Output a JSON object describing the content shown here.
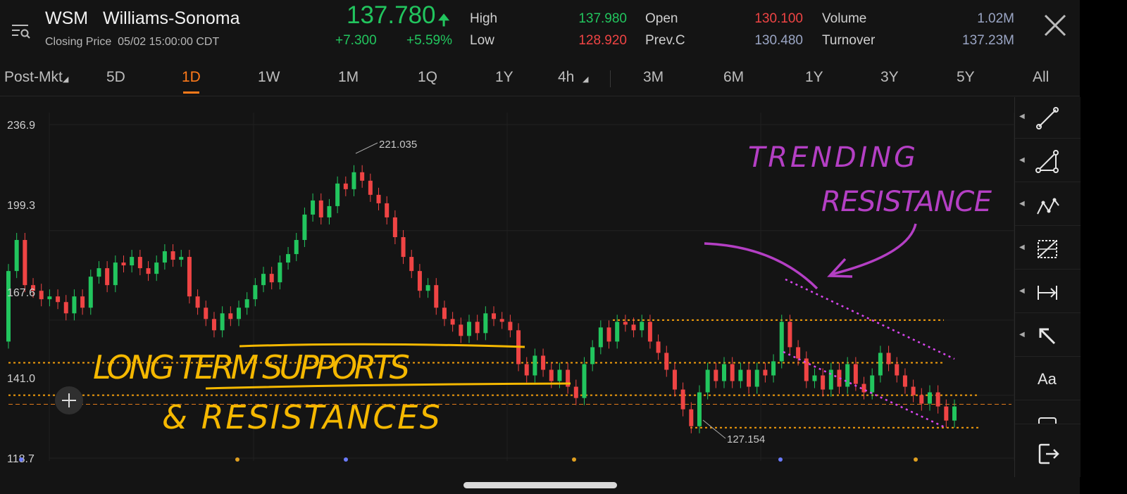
{
  "header": {
    "symbol": "WSM",
    "company": "Williams-Sonoma",
    "closing_label": "Closing Price",
    "closing_time": "05/02 15:00:00 CDT",
    "price": "137.780",
    "change": "+7.300",
    "change_pct": "+5.59%",
    "stats": {
      "high_label": "High",
      "high": "137.980",
      "low_label": "Low",
      "low": "128.920",
      "open_label": "Open",
      "open": "130.100",
      "prevc_label": "Prev.C",
      "prevc": "130.480",
      "volume_label": "Volume",
      "volume": "1.02M",
      "turnover_label": "Turnover",
      "turnover": "137.23M"
    },
    "colors": {
      "up": "#22c55e",
      "down": "#ef4444",
      "accent": "#ff7a1a"
    }
  },
  "tabs": [
    "Post-Mkt",
    "5D",
    "1D",
    "1W",
    "1M",
    "1Q",
    "1Y",
    "4h",
    "3M",
    "6M",
    "1Y",
    "3Y",
    "5Y",
    "All"
  ],
  "active_tab": "1D",
  "chart": {
    "y_ticks": [
      "236.9",
      "199.3",
      "167.6",
      "141.0",
      "118.7"
    ],
    "max_label": "221.035",
    "min_label": "127.154",
    "annotation_yellow_1": "LONG TERM SUPPORTS",
    "annotation_yellow_2": "& RESISTANCES",
    "annotation_purple_1": "TRENDING",
    "annotation_purple_2": "RESISTANCE",
    "support_levels": [
      167.6,
      152.5,
      141.0,
      129.5
    ],
    "current_price_line": 137.78
  },
  "toolbar": {
    "tools": [
      "line-tool-icon",
      "triangle-tool-icon",
      "pattern-tool-icon",
      "fib-tool-icon",
      "measure-tool-icon",
      "arrow-tool-icon",
      "text-tool-icon",
      "rect-tool-icon"
    ],
    "text_tool_label": "Aa"
  },
  "chart_data": {
    "type": "candlestick",
    "ylim": [
      118.7,
      236.9
    ],
    "y_ticks": [
      236.9,
      199.3,
      167.6,
      141.0,
      118.7
    ],
    "max": 221.035,
    "min": 127.154,
    "series": [
      {
        "name": "price",
        "values": [
          [
            160,
            185
          ],
          [
            185,
            196
          ],
          [
            196,
            180
          ],
          [
            180,
            178
          ],
          [
            178,
            175
          ],
          [
            175,
            176
          ],
          [
            176,
            174
          ],
          [
            174,
            170
          ],
          [
            170,
            176
          ],
          [
            176,
            172
          ],
          [
            172,
            183
          ],
          [
            183,
            186
          ],
          [
            186,
            180
          ],
          [
            180,
            188
          ],
          [
            188,
            187
          ],
          [
            187,
            190
          ],
          [
            190,
            186
          ],
          [
            186,
            184
          ],
          [
            184,
            188
          ],
          [
            188,
            192
          ],
          [
            192,
            189
          ],
          [
            189,
            190
          ],
          [
            190,
            176
          ],
          [
            176,
            172
          ],
          [
            172,
            168
          ],
          [
            168,
            164
          ],
          [
            164,
            170
          ],
          [
            170,
            168
          ],
          [
            168,
            172
          ],
          [
            172,
            175
          ],
          [
            175,
            180
          ],
          [
            180,
            184
          ],
          [
            184,
            181
          ],
          [
            181,
            188
          ],
          [
            188,
            191
          ],
          [
            191,
            196
          ],
          [
            196,
            205
          ],
          [
            205,
            210
          ],
          [
            210,
            204
          ],
          [
            204,
            208
          ],
          [
            208,
            216
          ],
          [
            216,
            214
          ],
          [
            214,
            220
          ],
          [
            220,
            217
          ],
          [
            217,
            212
          ],
          [
            212,
            209
          ],
          [
            209,
            204
          ],
          [
            204,
            197
          ],
          [
            197,
            190
          ],
          [
            190,
            185
          ],
          [
            185,
            178
          ],
          [
            178,
            180
          ],
          [
            180,
            172
          ],
          [
            172,
            168
          ],
          [
            168,
            166
          ],
          [
            166,
            162
          ],
          [
            162,
            167
          ],
          [
            167,
            163
          ],
          [
            163,
            170
          ],
          [
            170,
            168
          ],
          [
            168,
            167
          ],
          [
            167,
            164
          ],
          [
            164,
            152
          ],
          [
            152,
            148
          ],
          [
            148,
            155
          ],
          [
            155,
            150
          ],
          [
            150,
            146
          ],
          [
            146,
            150
          ],
          [
            150,
            144
          ],
          [
            144,
            140
          ],
          [
            140,
            152
          ],
          [
            152,
            158
          ],
          [
            158,
            165
          ],
          [
            165,
            160
          ],
          [
            160,
            167
          ],
          [
            167,
            166
          ],
          [
            166,
            164
          ],
          [
            164,
            167
          ],
          [
            167,
            160
          ],
          [
            160,
            156
          ],
          [
            156,
            150
          ],
          [
            150,
            143
          ],
          [
            143,
            136
          ],
          [
            136,
            130
          ],
          [
            130,
            142
          ],
          [
            142,
            150
          ],
          [
            150,
            146
          ],
          [
            146,
            152
          ],
          [
            152,
            146
          ],
          [
            146,
            150
          ],
          [
            150,
            144
          ],
          [
            144,
            150
          ],
          [
            150,
            148
          ],
          [
            148,
            153
          ],
          [
            153,
            167
          ],
          [
            167,
            158
          ],
          [
            158,
            154
          ],
          [
            154,
            146
          ],
          [
            146,
            148
          ],
          [
            148,
            143
          ],
          [
            143,
            150
          ],
          [
            150,
            144
          ],
          [
            144,
            152
          ],
          [
            152,
            145
          ],
          [
            145,
            142
          ],
          [
            142,
            148
          ],
          [
            148,
            156
          ],
          [
            156,
            152
          ],
          [
            152,
            148
          ],
          [
            148,
            144
          ],
          [
            144,
            141
          ],
          [
            141,
            138
          ],
          [
            138,
            142
          ],
          [
            142,
            137
          ],
          [
            137,
            132
          ],
          [
            132,
            137
          ]
        ]
      }
    ],
    "annotations": [
      "221.035",
      "127.154"
    ]
  }
}
